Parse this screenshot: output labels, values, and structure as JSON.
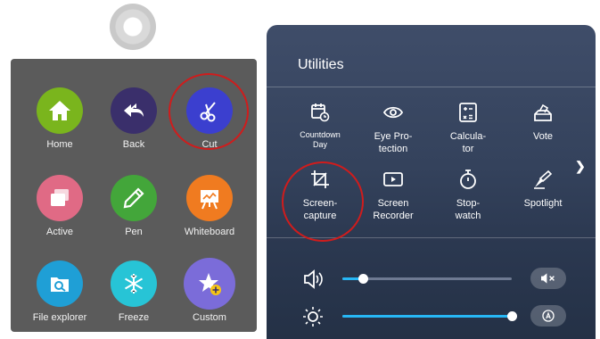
{
  "menu": {
    "items": [
      {
        "label": "Home",
        "icon": "home-icon",
        "color": "#7ab51d"
      },
      {
        "label": "Back",
        "icon": "back-icon",
        "color": "#3a2f6b"
      },
      {
        "label": "Cut",
        "icon": "scissors-icon",
        "color": "#3b3fcf"
      },
      {
        "label": "Active",
        "icon": "windows-icon",
        "color": "#e06a85"
      },
      {
        "label": "Pen",
        "icon": "pen-icon",
        "color": "#43a63a"
      },
      {
        "label": "Whiteboard",
        "icon": "whiteboard-icon",
        "color": "#f07b20"
      },
      {
        "label": "File explorer",
        "icon": "file-explorer-icon",
        "color": "#1f9fd6"
      },
      {
        "label": "Freeze",
        "icon": "snowflake-icon",
        "color": "#27c4d6"
      },
      {
        "label": "Custom",
        "icon": "star-plus-icon",
        "color": "#7b6cd9"
      }
    ]
  },
  "utilities": {
    "title": "Utilities",
    "tools": [
      {
        "label": "Countdown Day",
        "icon": "calendar-clock-icon"
      },
      {
        "label": "Eye Pro-tection",
        "icon": "eye-icon"
      },
      {
        "label": "Calcula-tor",
        "icon": "calculator-icon"
      },
      {
        "label": "Vote",
        "icon": "vote-icon"
      },
      {
        "label": "Screen-capture",
        "icon": "crop-icon"
      },
      {
        "label": "Screen Recorder",
        "icon": "record-icon"
      },
      {
        "label": "Stop-watch",
        "icon": "stopwatch-icon"
      },
      {
        "label": "Spotlight",
        "icon": "spotlight-icon"
      }
    ],
    "volume": {
      "level": 0.12,
      "icon": "speaker-icon",
      "mute_icon": "mute-icon"
    },
    "brightness": {
      "level": 1.0,
      "icon": "sun-icon",
      "auto_icon": "auto-brightness-icon"
    },
    "accent": "#27b7f5"
  },
  "annotation_color": "#d01c1c"
}
